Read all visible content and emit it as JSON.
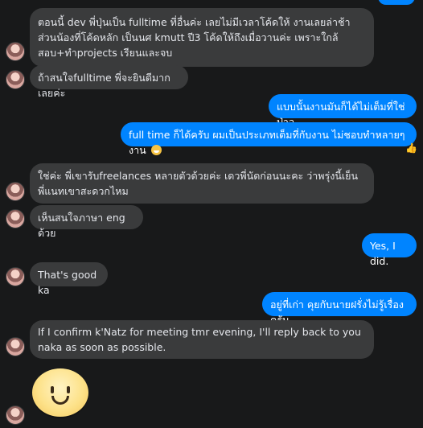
{
  "messages": {
    "m1": "ตอนนี้ dev พี่ปุ่นเป็น fulltime ที่อื่นค่ะ เลยไม่มีเวลาโค้ดให้ งานเลยล่าช้า ส่วนน้องที่โค้ดหลัก เป็นนศ kmutt ปี3 โค้ดให้ถึงเมื่อวานค่ะ เพราะใกล้สอบ+ทำprojects เรียนและจบ",
    "m2": "ถ้าสนใจfulltime พี่จะยินดีมากเลยค่ะ",
    "m3": "แบบนั้นงานมันก็ได้ไม่เต็มที่ใช่ป่าว",
    "m4": "full time ก็ได้ครับ ผมเป็นประเภทเต็มที่กับงาน ไม่ชอบทำหลายๆงาน",
    "m5": "ใช่ค่ะ พี่เขารับfreelances หลายตัวด้วยค่ะ เดวพี่นัดก่อนนะคะ ว่าพรุ่งนี้เย็น พี่แนทเขาสะดวกไหม",
    "m6": "เห็นสนใจภาษา eng ด้วย",
    "m7": "Yes, I did.",
    "m8": "That's good ka",
    "m9": "อยู่ที่เก่า คุยกับนายฝรั่งไม่รู้เรื่องครับ",
    "m10": "If I confirm k'Natz for meeting tmr evening, I'll reply back to you naka as soon as possible."
  },
  "reaction_emoji": "👍",
  "colors": {
    "background": "#18191a",
    "incoming_bubble": "#3a3b3c",
    "outgoing_bubble": "#0084ff",
    "text_light": "#e4e6eb"
  },
  "icons": {
    "avatar": "avatar",
    "sticker": "smiley-sticker-icon",
    "emoji": "grinning-emoji-icon",
    "reaction": "thumbs-up-icon"
  }
}
